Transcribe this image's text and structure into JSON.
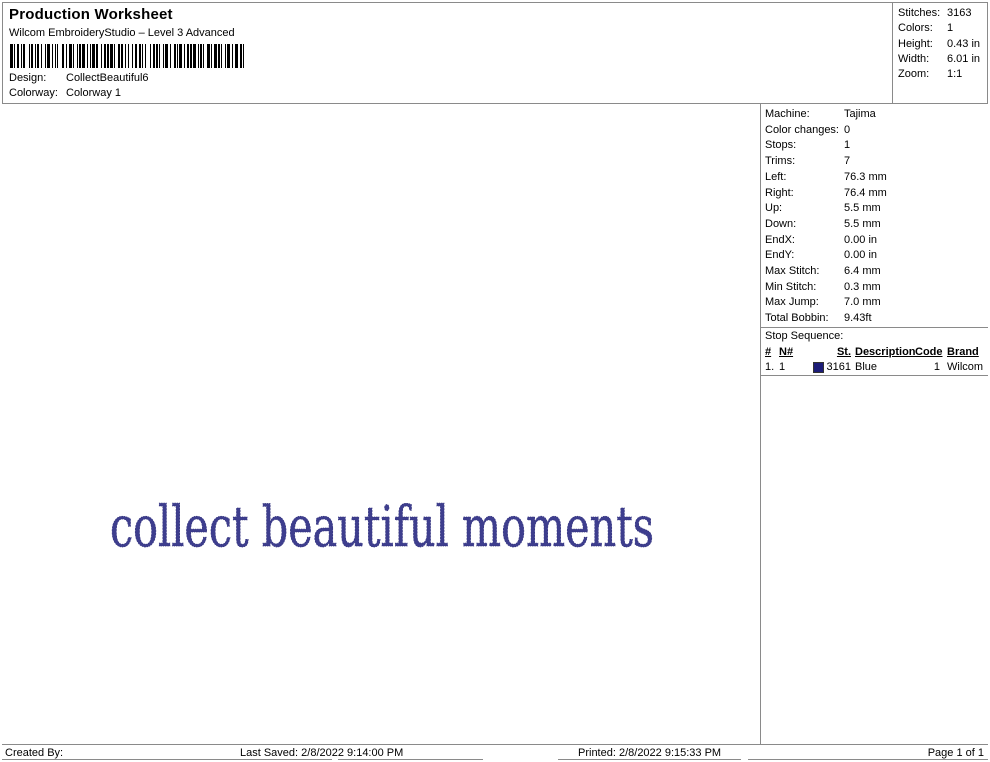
{
  "header": {
    "title": "Production Worksheet",
    "subtitle": "Wilcom EmbroideryStudio – Level 3 Advanced",
    "design_label": "Design:",
    "design_value": "CollectBeautiful6",
    "colorway_label": "Colorway:",
    "colorway_value": "Colorway 1",
    "barcode_pattern": "3111221123112211121311221211132212211311212212112123121121311221221113122121121312212112113212211131122121221121123112212113112212312112"
  },
  "stats": {
    "rows": [
      {
        "label": "Stitches:",
        "value": "3163"
      },
      {
        "label": "Colors:",
        "value": "1"
      },
      {
        "label": "Height:",
        "value": "0.43 in"
      },
      {
        "label": "Width:",
        "value": "6.01 in"
      },
      {
        "label": "Zoom:",
        "value": "1:1"
      }
    ]
  },
  "machine_info": {
    "rows": [
      {
        "label": "Machine:",
        "value": "Tajima"
      },
      {
        "label": "Color changes:",
        "value": "0"
      },
      {
        "label": "Stops:",
        "value": "1"
      },
      {
        "label": "Trims:",
        "value": "7"
      },
      {
        "label": "Left:",
        "value": "76.3 mm"
      },
      {
        "label": "Right:",
        "value": "76.4 mm"
      },
      {
        "label": "Up:",
        "value": "5.5 mm"
      },
      {
        "label": "Down:",
        "value": "5.5 mm"
      },
      {
        "label": "EndX:",
        "value": "0.00 in"
      },
      {
        "label": "EndY:",
        "value": "0.00 in"
      },
      {
        "label": "Max Stitch:",
        "value": "6.4 mm"
      },
      {
        "label": "Min Stitch:",
        "value": "0.3 mm"
      },
      {
        "label": "Max Jump:",
        "value": "7.0 mm"
      },
      {
        "label": "Total Bobbin:",
        "value": "9.43ft"
      }
    ]
  },
  "stop_sequence": {
    "title": "Stop Sequence:",
    "columns": [
      "#",
      "N#",
      "St.",
      "Description",
      "Code",
      "Brand"
    ],
    "rows": [
      {
        "num": "1.",
        "n": "1",
        "chip_color": "#1c1c78",
        "st": "3161",
        "description": "Blue",
        "code": "1",
        "brand": "Wilcom"
      }
    ]
  },
  "canvas": {
    "design_text": "collect beautiful moments",
    "thread_color": "#3e3e8e",
    "thread_stroke": "#31317c"
  },
  "footer": {
    "created_by": "Created By:",
    "last_saved": "Last Saved: 2/8/2022 9:14:00 PM",
    "printed": "Printed: 2/8/2022 9:15:33 PM",
    "page": "Page 1 of 1"
  }
}
